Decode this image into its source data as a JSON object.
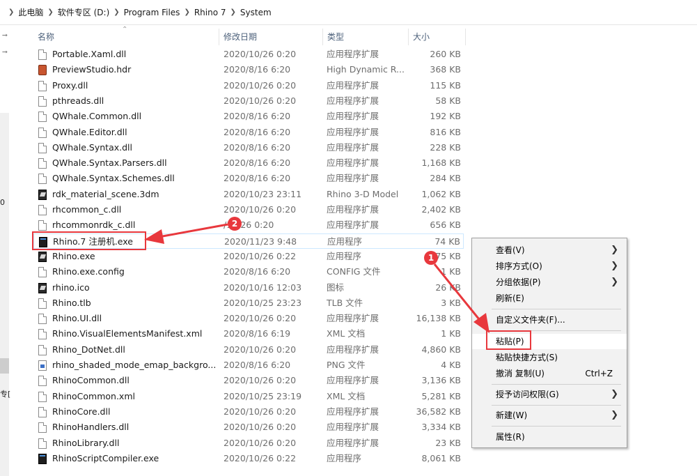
{
  "breadcrumb": {
    "items": [
      "此电脑",
      "软件专区 (D:)",
      "Program Files",
      "Rhino 7",
      "System"
    ]
  },
  "left_pane": {
    "fragment_zero": "0",
    "fragment_zhuan": "专["
  },
  "columns": {
    "name": "名称",
    "date": "修改日期",
    "type": "类型",
    "size": "大小"
  },
  "files": [
    {
      "name": "Portable.Xaml.dll",
      "date": "2020/10/26 0:20",
      "type": "应用程序扩展",
      "size": "260 KB",
      "icon": "doc"
    },
    {
      "name": "PreviewStudio.hdr",
      "date": "2020/8/16 6:20",
      "type": "High Dynamic R...",
      "size": "368 KB",
      "icon": "hdr"
    },
    {
      "name": "Proxy.dll",
      "date": "2020/10/26 0:20",
      "type": "应用程序扩展",
      "size": "115 KB",
      "icon": "doc"
    },
    {
      "name": "pthreads.dll",
      "date": "2020/10/26 0:20",
      "type": "应用程序扩展",
      "size": "58 KB",
      "icon": "doc"
    },
    {
      "name": "QWhale.Common.dll",
      "date": "2020/8/16 6:20",
      "type": "应用程序扩展",
      "size": "192 KB",
      "icon": "doc"
    },
    {
      "name": "QWhale.Editor.dll",
      "date": "2020/8/16 6:20",
      "type": "应用程序扩展",
      "size": "816 KB",
      "icon": "doc"
    },
    {
      "name": "QWhale.Syntax.dll",
      "date": "2020/8/16 6:20",
      "type": "应用程序扩展",
      "size": "228 KB",
      "icon": "doc"
    },
    {
      "name": "QWhale.Syntax.Parsers.dll",
      "date": "2020/8/16 6:20",
      "type": "应用程序扩展",
      "size": "1,168 KB",
      "icon": "doc"
    },
    {
      "name": "QWhale.Syntax.Schemes.dll",
      "date": "2020/8/16 6:20",
      "type": "应用程序扩展",
      "size": "284 KB",
      "icon": "doc"
    },
    {
      "name": "rdk_material_scene.3dm",
      "date": "2020/10/23 23:11",
      "type": "Rhino 3-D Model",
      "size": "1,062 KB",
      "icon": "rhino"
    },
    {
      "name": "rhcommon_c.dll",
      "date": "2020/10/26 0:20",
      "type": "应用程序扩展",
      "size": "2,402 KB",
      "icon": "doc"
    },
    {
      "name": "rhcommonrdk_c.dll",
      "date": "/10/26 0:20",
      "type": "应用程序扩展",
      "size": "656 KB",
      "icon": "doc"
    },
    {
      "name": "Rhino.7 注册机.exe",
      "date": "2020/11/23 9:48",
      "type": "应用程序",
      "size": "74 KB",
      "icon": "exe"
    },
    {
      "name": "Rhino.exe",
      "date": "2020/10/26 0:22",
      "type": "应用程序",
      "size": "75 KB",
      "icon": "rhino"
    },
    {
      "name": "Rhino.exe.config",
      "date": "2020/8/16 6:20",
      "type": "CONFIG 文件",
      "size": "1 KB",
      "icon": "doc"
    },
    {
      "name": "rhino.ico",
      "date": "2020/10/16 12:03",
      "type": "图标",
      "size": "26 KB",
      "icon": "rhino"
    },
    {
      "name": "Rhino.tlb",
      "date": "2020/10/25 23:23",
      "type": "TLB 文件",
      "size": "3 KB",
      "icon": "doc"
    },
    {
      "name": "Rhino.UI.dll",
      "date": "2020/10/26 0:20",
      "type": "应用程序扩展",
      "size": "16,138 KB",
      "icon": "doc"
    },
    {
      "name": "Rhino.VisualElementsManifest.xml",
      "date": "2020/8/16 6:19",
      "type": "XML 文档",
      "size": "1 KB",
      "icon": "doc"
    },
    {
      "name": "Rhino_DotNet.dll",
      "date": "2020/10/26 0:20",
      "type": "应用程序扩展",
      "size": "4,860 KB",
      "icon": "doc"
    },
    {
      "name": "rhino_shaded_mode_emap_backgro...",
      "date": "2020/8/16 6:20",
      "type": "PNG 文件",
      "size": "4 KB",
      "icon": "img"
    },
    {
      "name": "RhinoCommon.dll",
      "date": "2020/10/26 0:20",
      "type": "应用程序扩展",
      "size": "3,136 KB",
      "icon": "doc"
    },
    {
      "name": "RhinoCommon.xml",
      "date": "2020/10/25 23:19",
      "type": "XML 文档",
      "size": "5,281 KB",
      "icon": "doc"
    },
    {
      "name": "RhinoCore.dll",
      "date": "2020/10/26 0:20",
      "type": "应用程序扩展",
      "size": "36,582 KB",
      "icon": "doc"
    },
    {
      "name": "RhinoHandlers.dll",
      "date": "2020/10/26 0:20",
      "type": "应用程序扩展",
      "size": "3,334 KB",
      "icon": "doc"
    },
    {
      "name": "RhinoLibrary.dll",
      "date": "2020/10/26 0:20",
      "type": "应用程序扩展",
      "size": "23 KB",
      "icon": "doc"
    },
    {
      "name": "RhinoScriptCompiler.exe",
      "date": "2020/10/26 0:22",
      "type": "应用程序",
      "size": "8,061 KB",
      "icon": "exe"
    }
  ],
  "context_menu": {
    "view": "查看(V)",
    "sort": "排序方式(O)",
    "group": "分组依据(P)",
    "refresh": "刷新(E)",
    "customize": "自定义文件夹(F)...",
    "paste": "粘贴(P)",
    "paste_shortcut": "粘贴快捷方式(S)",
    "undo": "撤消 复制(U)",
    "undo_shortcut": "Ctrl+Z",
    "grant_access": "授予访问权限(G)",
    "new": "新建(W)",
    "properties": "属性(R)"
  },
  "annotations": {
    "badge_1": "1",
    "badge_2": "2",
    "accent_color": "#e8383d"
  }
}
